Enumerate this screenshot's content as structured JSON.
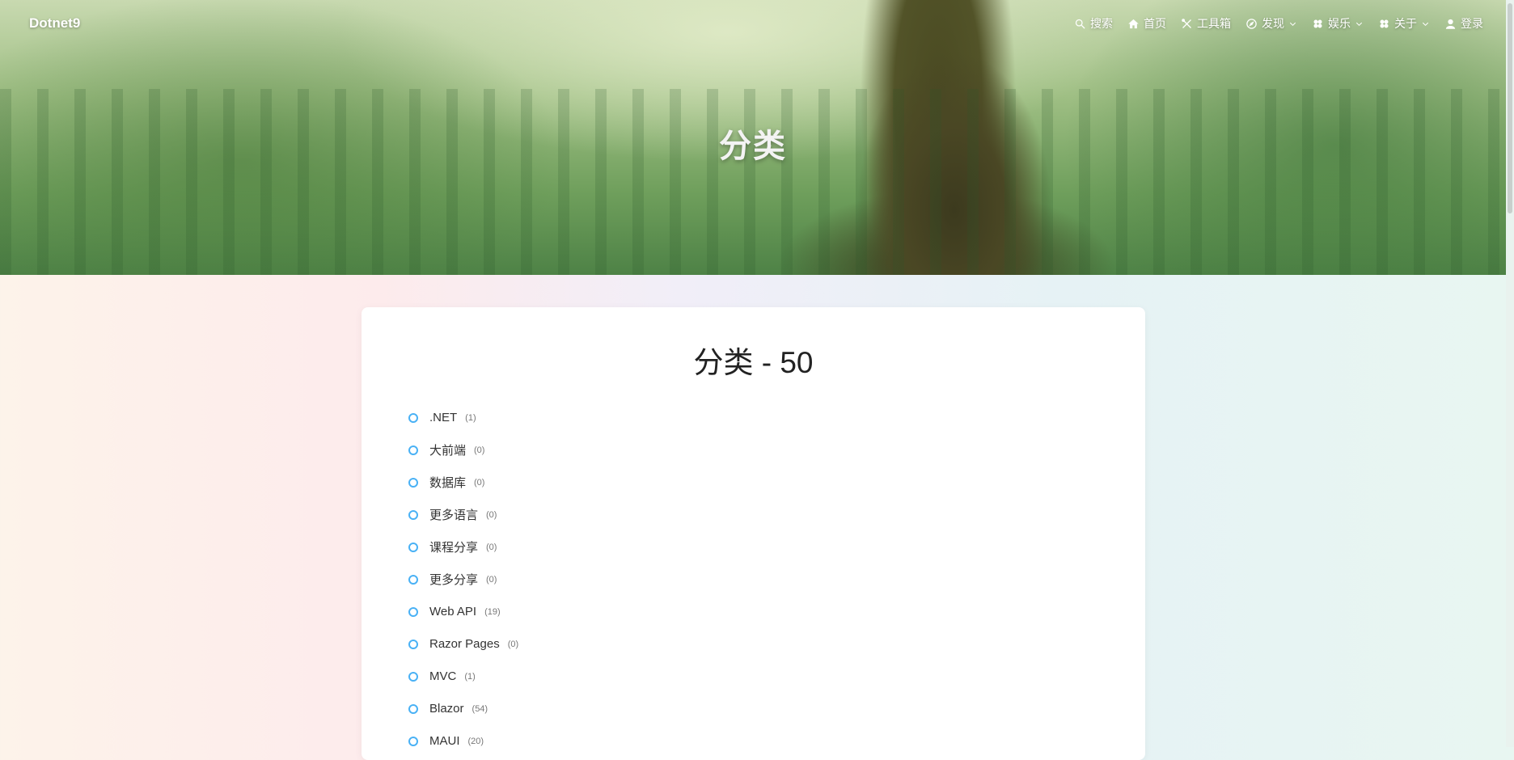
{
  "header": {
    "brand": "Dotnet9",
    "nav": [
      {
        "label": "搜索",
        "icon": "search-icon",
        "dropdown": false
      },
      {
        "label": "首页",
        "icon": "home-icon",
        "dropdown": false
      },
      {
        "label": "工具箱",
        "icon": "tools-icon",
        "dropdown": false
      },
      {
        "label": "发现",
        "icon": "compass-icon",
        "dropdown": true
      },
      {
        "label": "娱乐",
        "icon": "game-icon",
        "dropdown": true
      },
      {
        "label": "关于",
        "icon": "game-icon",
        "dropdown": true
      },
      {
        "label": "登录",
        "icon": "user-icon",
        "dropdown": false
      }
    ]
  },
  "hero": {
    "title": "分类"
  },
  "page": {
    "title": "分类 - 50"
  },
  "categories": [
    {
      "name": ".NET",
      "count": "(1)"
    },
    {
      "name": "大前端",
      "count": "(0)"
    },
    {
      "name": "数据库",
      "count": "(0)"
    },
    {
      "name": "更多语言",
      "count": "(0)"
    },
    {
      "name": "课程分享",
      "count": "(0)"
    },
    {
      "name": "更多分享",
      "count": "(0)"
    },
    {
      "name": "Web API",
      "count": "(19)"
    },
    {
      "name": "Razor Pages",
      "count": "(0)"
    },
    {
      "name": "MVC",
      "count": "(1)"
    },
    {
      "name": "Blazor",
      "count": "(54)"
    },
    {
      "name": "MAUI",
      "count": "(20)"
    }
  ],
  "colors": {
    "accent": "#49b1f5"
  }
}
